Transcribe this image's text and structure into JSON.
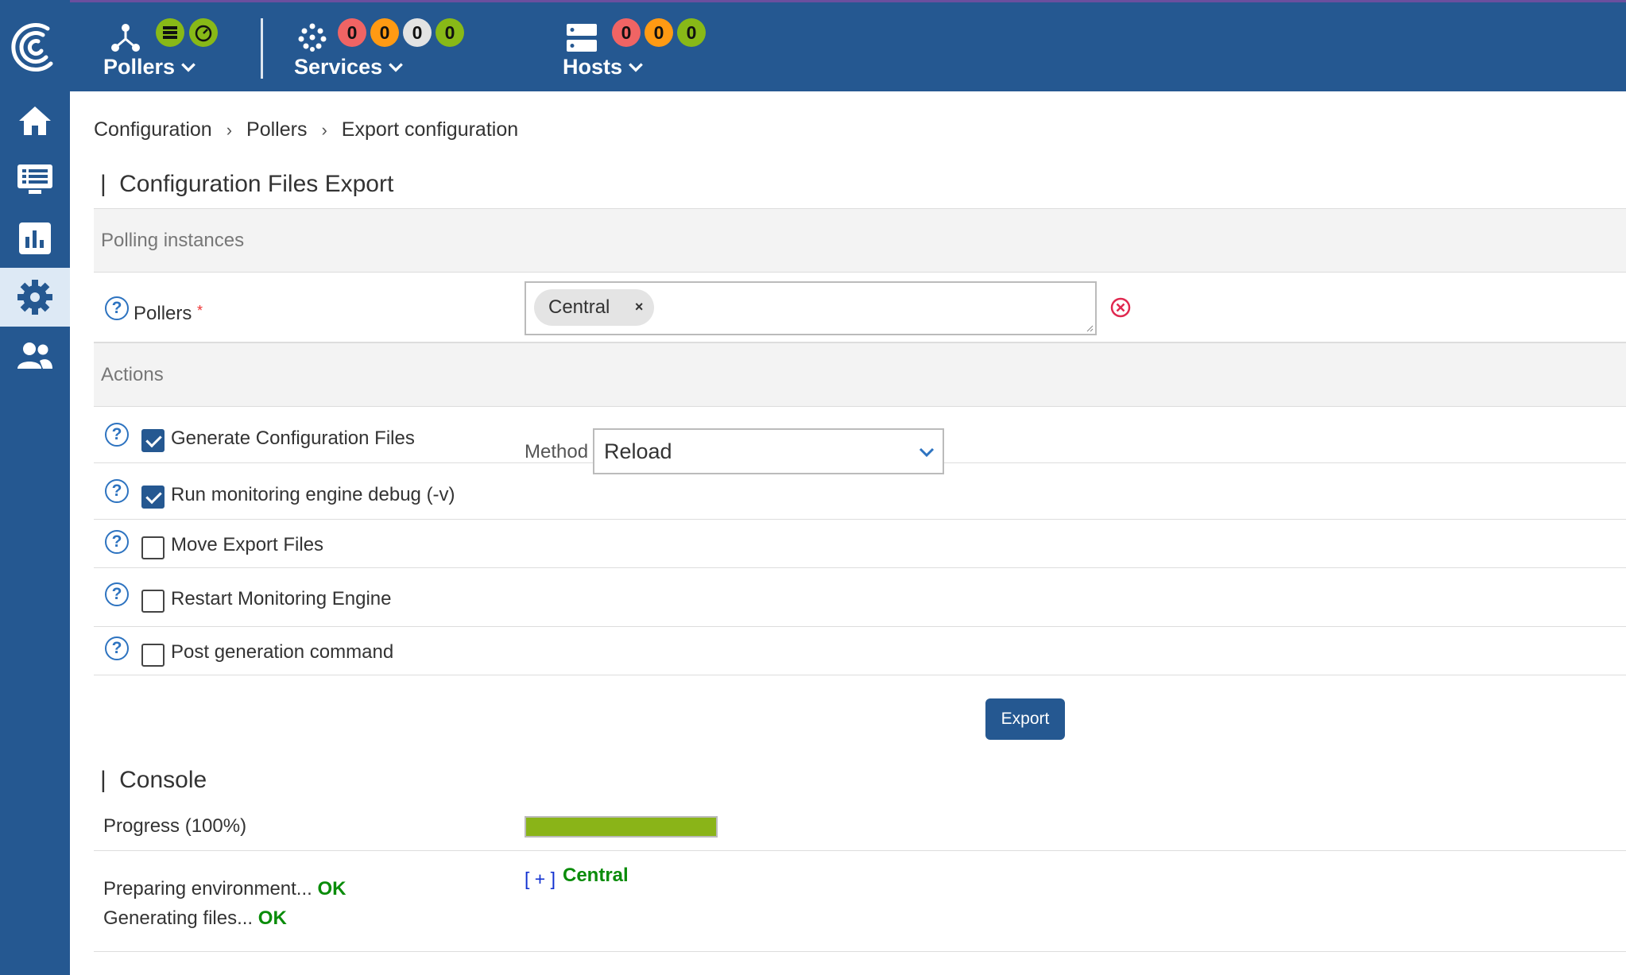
{
  "topbar": {
    "pollers": {
      "label": "Pollers"
    },
    "services": {
      "label": "Services",
      "badges": [
        "0",
        "0",
        "0",
        "0"
      ]
    },
    "hosts": {
      "label": "Hosts",
      "badges": [
        "0",
        "0",
        "0"
      ]
    }
  },
  "colors": {
    "brand": "#255891",
    "critical": "#f06464",
    "warning": "#ff9a13",
    "unknown": "#e3e3e3",
    "ok": "#88b917",
    "progress": "#8ab418"
  },
  "sidebar": {
    "items": [
      {
        "icon": "home-icon"
      },
      {
        "icon": "monitoring-icon"
      },
      {
        "icon": "reporting-icon"
      },
      {
        "icon": "configuration-gear-icon",
        "active": true
      },
      {
        "icon": "administration-users-icon"
      }
    ]
  },
  "breadcrumb": [
    "Configuration",
    "Pollers",
    "Export configuration"
  ],
  "page_title": "Configuration Files Export",
  "polling": {
    "section_label": "Polling instances",
    "pollers_label": "Pollers",
    "required_mark": "*",
    "selected": [
      "Central"
    ],
    "chip_remove": "×"
  },
  "actions": {
    "section_label": "Actions",
    "items": [
      {
        "label": "Generate Configuration Files",
        "checked": true
      },
      {
        "label": "Run monitoring engine debug (-v)",
        "checked": true
      },
      {
        "label": "Move Export Files",
        "checked": false
      },
      {
        "label": "Restart Monitoring Engine",
        "checked": false
      },
      {
        "label": "Post generation command",
        "checked": false
      }
    ],
    "method_label": "Method",
    "method_value": "Reload",
    "help_glyph": "?"
  },
  "export_button": "Export",
  "console": {
    "title": "Console",
    "progress_label": "Progress",
    "progress_text": "(100%)",
    "progress_value": 1.0,
    "lines": [
      {
        "text": "Preparing environment...",
        "status": "OK"
      },
      {
        "text": "Generating files...",
        "status": "OK"
      }
    ],
    "expand_label": "[ + ]",
    "poller_name": "Central"
  }
}
